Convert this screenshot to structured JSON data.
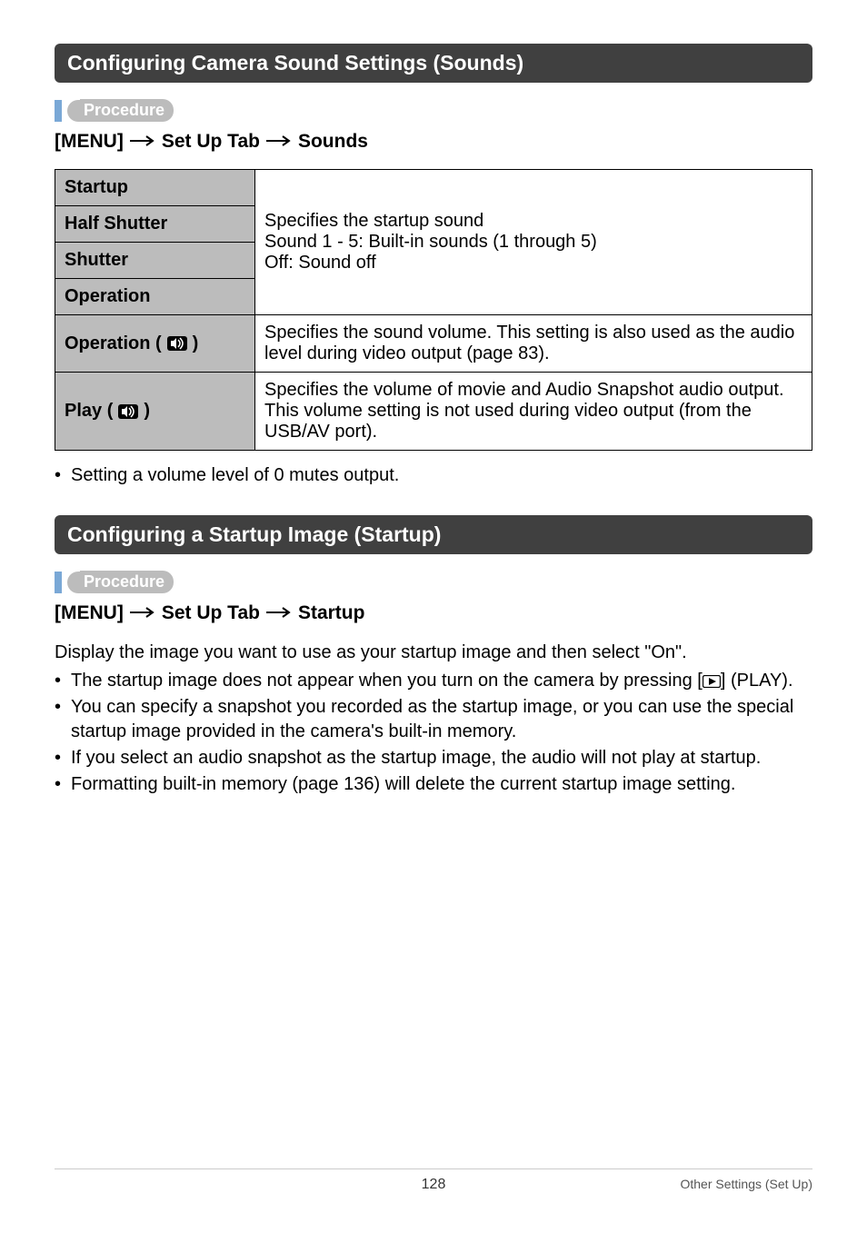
{
  "section1": {
    "title": "Configuring Camera Sound Settings (Sounds)",
    "procedure_label": "Procedure",
    "path": {
      "menu": "[MENU]",
      "tab": "Set Up Tab",
      "item": "Sounds"
    },
    "table": {
      "rows": [
        {
          "label": "Startup"
        },
        {
          "label": "Half Shutter"
        },
        {
          "label": "Shutter"
        },
        {
          "label": "Operation"
        }
      ],
      "group_desc_line1": "Specifies the startup sound",
      "group_desc_line2": "Sound 1 - 5: Built-in sounds (1 through 5)",
      "group_desc_line3": "Off: Sound off",
      "op_vol_label": "Operation (",
      "op_vol_label_close": ")",
      "op_vol_desc": "Specifies the sound volume. This setting is also used as the audio level during video output (page 83).",
      "play_label": "Play (",
      "play_label_close": ")",
      "play_desc": "Specifies the volume of movie and Audio Snapshot audio output. This volume setting is not used during video output (from the USB/AV port)."
    },
    "note": "Setting a volume level of 0 mutes output."
  },
  "section2": {
    "title": "Configuring a Startup Image (Startup)",
    "procedure_label": "Procedure",
    "path": {
      "menu": "[MENU]",
      "tab": "Set Up Tab",
      "item": "Startup"
    },
    "intro": "Display the image you want to use as your startup image and then select \"On\".",
    "b1a": "The startup image does not appear when you turn on the camera by pressing [",
    "b1b": "] (PLAY).",
    "b2": "You can specify a snapshot you recorded as the startup image, or you can use the special startup image provided in the camera's built-in memory.",
    "b3": "If you select an audio snapshot as the startup image, the audio will not play at startup.",
    "b4": "Formatting built-in memory (page 136) will delete the current startup image setting."
  },
  "footer": {
    "page": "128",
    "section": "Other Settings (Set Up)"
  }
}
